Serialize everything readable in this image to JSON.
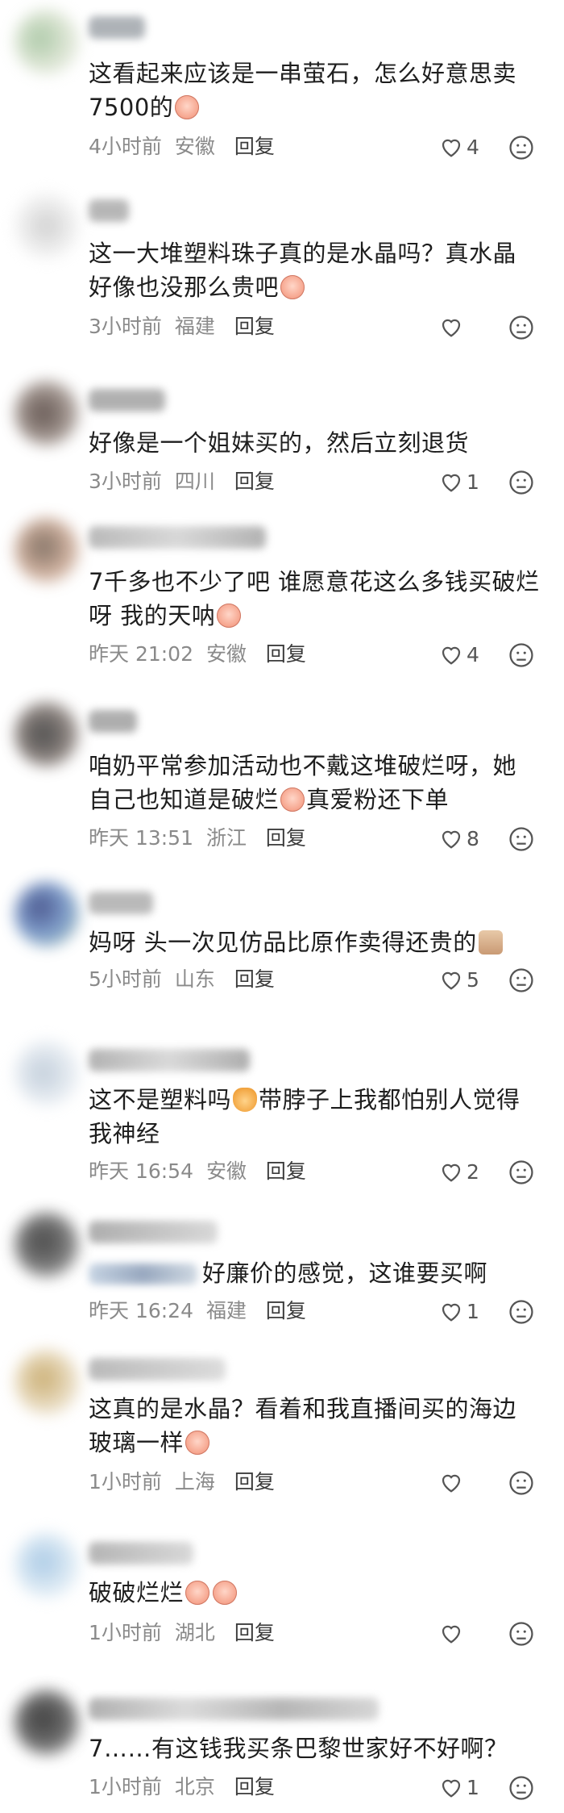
{
  "comments": [
    {
      "text": "这看起来应该是一串萤石，怎么好意思卖7500的",
      "text_emoji": "",
      "time": "4小时前",
      "location": "安徽",
      "reply": "回复",
      "likes": "4"
    },
    {
      "text": "这一大堆塑料珠子真的是水晶吗？真水晶好像也没那么贵吧",
      "time": "3小时前",
      "location": "福建",
      "reply": "回复",
      "likes": ""
    },
    {
      "text": "好像是一个姐妹买的，然后立刻退货",
      "time": "3小时前",
      "location": "四川",
      "reply": "回复",
      "likes": "1"
    },
    {
      "text": "7千多也不少了吧 谁愿意花这么多钱买破烂呀 我的天呐",
      "time": "昨天 21:02",
      "location": "安徽",
      "reply": "回复",
      "likes": "4"
    },
    {
      "text_a": "咱奶平常参加活动也不戴这堆破烂呀，她自己也知道是破烂",
      "text_b": "真爱粉还下单",
      "time": "昨天 13:51",
      "location": "浙江",
      "reply": "回复",
      "likes": "8"
    },
    {
      "text": "妈呀 头一次见仿品比原作卖得还贵的",
      "time": "5小时前",
      "location": "山东",
      "reply": "回复",
      "likes": "5"
    },
    {
      "text_a": "这不是塑料吗",
      "text_b": "带脖子上我都怕别人觉得我神经",
      "time": "昨天 16:54",
      "location": "安徽",
      "reply": "回复",
      "likes": "2"
    },
    {
      "text": "好廉价的感觉，这谁要买啊",
      "time": "昨天 16:24",
      "location": "福建",
      "reply": "回复",
      "likes": "1"
    },
    {
      "text": "这真的是水晶？看着和我直播间买的海边玻璃一样",
      "time": "1小时前",
      "location": "上海",
      "reply": "回复",
      "likes": ""
    },
    {
      "text": "破破烂烂",
      "time": "1小时前",
      "location": "湖北",
      "reply": "回复",
      "likes": ""
    },
    {
      "text": "7……有这钱我买条巴黎世家好不好啊？",
      "time": "1小时前",
      "location": "北京",
      "reply": "回复",
      "likes": "1"
    }
  ],
  "icons": {
    "like": "heart-outline-icon",
    "dislike": "unhappy-face-icon"
  },
  "colors": {
    "text": "#1e1e1e",
    "meta": "#8a8a8a",
    "icon": "#555555"
  }
}
